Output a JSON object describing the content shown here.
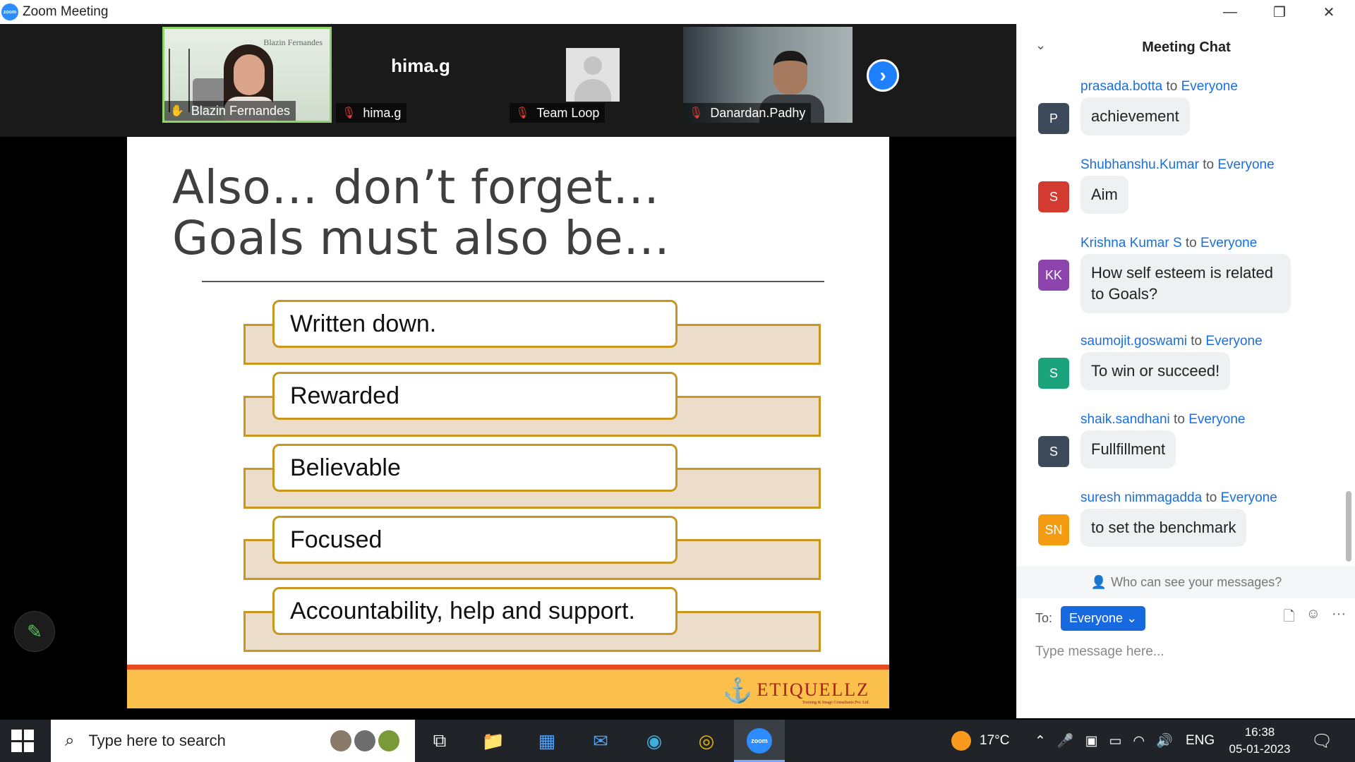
{
  "window": {
    "logo_text": "zoom",
    "title": "Zoom Meeting",
    "minimize": "—",
    "restore": "❐",
    "close": "✕"
  },
  "participants": [
    {
      "name": "Blazin Fernandes",
      "watermark": "Blazin Fernandes",
      "status": "speaking"
    },
    {
      "name": "hima.g",
      "display": "hima.g",
      "status": "muted"
    },
    {
      "name": "Team Loop",
      "status": "muted"
    },
    {
      "name": "Danardan.Padhy",
      "status": "muted"
    }
  ],
  "next_page": "›",
  "slide": {
    "title_line1": "Also… don’t forget…",
    "title_line2": "Goals must also be…",
    "items": [
      "Written down.",
      "Rewarded",
      "Believable",
      "Focused",
      "Accountability, help and support."
    ],
    "logo_text": "ETIQUELLZ",
    "logo_tagline": "Training & Image Consultants Pvt. Ltd."
  },
  "annotate": {
    "icon": "pencil-icon",
    "glyph": "✎"
  },
  "chat": {
    "title": "Meeting Chat",
    "collapse": "⌄",
    "messages": [
      {
        "initials": "P",
        "color": "#3d4a5c",
        "sender": "prasada.botta",
        "to": "to",
        "recipient": "Everyone",
        "text": "achievement"
      },
      {
        "initials": "S",
        "color": "#d43b30",
        "sender": "Shubhanshu.Kumar",
        "to": "to",
        "recipient": "Everyone",
        "text": "Aim"
      },
      {
        "initials": "KK",
        "color": "#8e44ad",
        "sender": "Krishna Kumar S",
        "to": "to",
        "recipient": "Everyone",
        "text": "How self esteem is related to Goals?"
      },
      {
        "initials": "S",
        "color": "#1aa37a",
        "sender": "saumojit.goswami",
        "to": "to",
        "recipient": "Everyone",
        "text": "To win or succeed!"
      },
      {
        "initials": "S",
        "color": "#3d4a5c",
        "sender": "shaik.sandhani",
        "to": "to",
        "recipient": "Everyone",
        "text": "Fullfillment"
      },
      {
        "initials": "SN",
        "color": "#f39c12",
        "sender": "suresh nimmagadda",
        "to": "to",
        "recipient": "Everyone",
        "text": "to set the benchmark"
      }
    ],
    "who_can_see": "Who can see your messages?",
    "to_label": "To:",
    "to_value": "Everyone",
    "placeholder": "Type message here...",
    "tools": {
      "file": "🗋",
      "emoji": "☺",
      "more": "···"
    }
  },
  "taskbar": {
    "search_placeholder": "Type here to search",
    "weather": "17°C",
    "language": "ENG",
    "time": "16:38",
    "date": "05-01-2023"
  }
}
